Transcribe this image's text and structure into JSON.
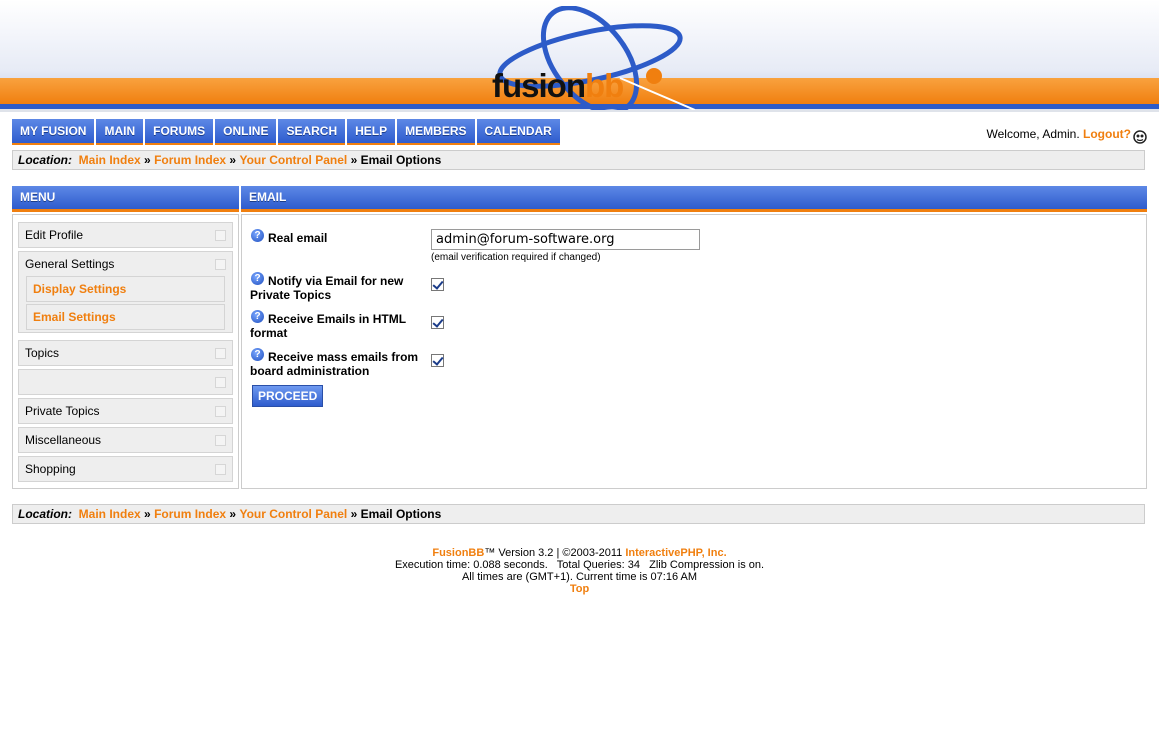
{
  "logo": {
    "text_main": "fusion",
    "text_accent": "bb"
  },
  "nav": [
    {
      "label": "MY FUSION"
    },
    {
      "label": "MAIN"
    },
    {
      "label": "FORUMS"
    },
    {
      "label": "ONLINE"
    },
    {
      "label": "SEARCH"
    },
    {
      "label": "HELP"
    },
    {
      "label": "MEMBERS"
    },
    {
      "label": "CALENDAR"
    }
  ],
  "welcome": {
    "text": "Welcome, Admin.",
    "logout": "Logout?"
  },
  "location": {
    "label": "Location:",
    "crumbs": [
      "Main Index",
      "Forum Index",
      "Your Control Panel"
    ],
    "separator": "»",
    "current": "Email Options"
  },
  "menu": {
    "title": "MENU",
    "items": [
      {
        "label": "Edit Profile"
      },
      {
        "label": "General Settings"
      },
      {
        "label": "Topics"
      },
      {
        "label": ""
      },
      {
        "label": "Private Topics"
      },
      {
        "label": "Miscellaneous"
      },
      {
        "label": "Shopping"
      }
    ],
    "sub_items": [
      {
        "label": "Display Settings"
      },
      {
        "label": "Email Settings"
      }
    ]
  },
  "email": {
    "title": "EMAIL",
    "real_email_label": "Real email",
    "real_email_value": "admin@forum-software.org",
    "real_email_hint": "(email verification required if changed)",
    "notify_label_1": "Notify via Email for new",
    "notify_label_2": "Private Topics",
    "html_label_1": "Receive Emails in HTML",
    "html_label_2": "format",
    "mass_label_1": "Receive mass emails from",
    "mass_label_2": "board administration",
    "proceed": "PROCEED"
  },
  "footer": {
    "brand": "FusionBB",
    "version": "™ Version 3.2 | ©2003-2011",
    "company": "InteractivePHP, Inc.",
    "line2": "Execution time: 0.088 seconds.   Total Queries: 34   Zlib Compression is on.",
    "line3": "All times are (GMT+1). Current time is 07:16 AM",
    "top": "Top"
  },
  "colors": {
    "accent": "#f07f0f",
    "nav_blue": "#2e5ccd",
    "panel_gray": "#eeeeee"
  }
}
